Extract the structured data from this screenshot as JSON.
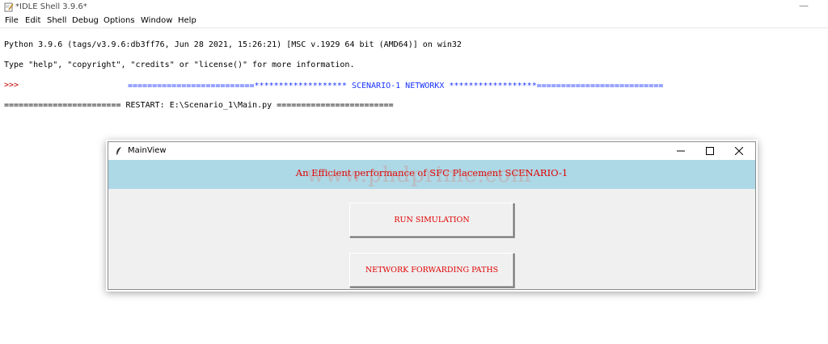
{
  "idle": {
    "title": "*IDLE Shell 3.9.6*",
    "minimize_glyph": "—",
    "menu": [
      "File",
      "Edit",
      "Shell",
      "Debug",
      "Options",
      "Window",
      "Help"
    ]
  },
  "shell": {
    "line1": "Python 3.9.6 (tags/v3.9.6:db3ff76, Jun 28 2021, 15:26:21) [MSC v.1929 64 bit (AMD64)] on win32",
    "line2": "Type \"help\", \"copyright\", \"credits\" or \"license()\" for more information.",
    "prompt": ">>>",
    "restart": "======================== RESTART: E:\\Scenario_1\\Main.py ========================",
    "scenario": "==========================******************* SCENARIO-1 NETWORKX ******************=========================="
  },
  "mainview": {
    "title": "MainView",
    "banner": "An Efficient performance of SFC Placement SCENARIO-1",
    "watermark": "www.phdprime.com",
    "buttons": {
      "run": "RUN SIMULATION",
      "paths": "NETWORK FORWARDING PATHS"
    }
  },
  "colors": {
    "banner_bg": "#add8e6",
    "accent_red": "#e00000",
    "scenario_blue": "#1a34ff",
    "prompt_red": "#c00000"
  },
  "icons": [
    "idle-app-icon",
    "feather-icon",
    "minimize-icon",
    "maximize-icon",
    "close-icon"
  ]
}
